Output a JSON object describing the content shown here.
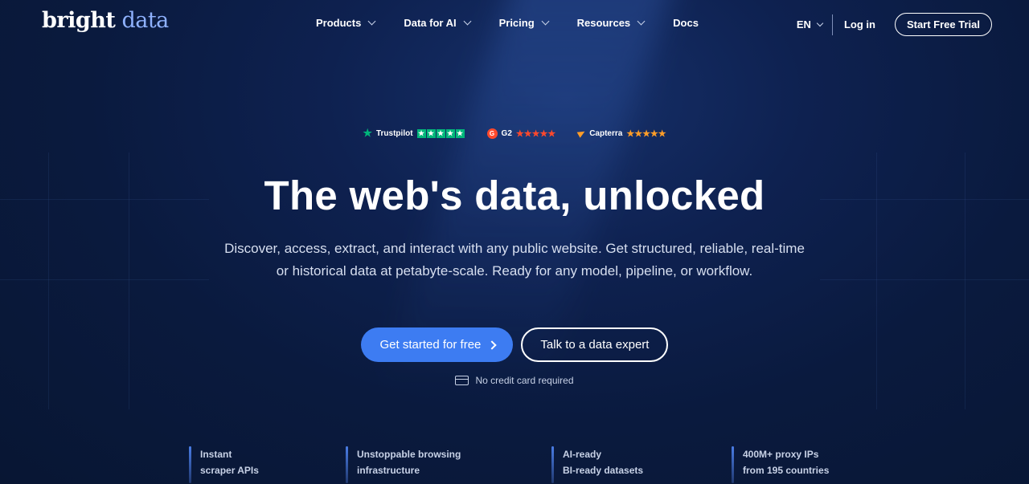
{
  "brand": {
    "word1": "bright",
    "word2": "data"
  },
  "nav": {
    "items": [
      {
        "label": "Products",
        "has_dropdown": true
      },
      {
        "label": "Data for AI",
        "has_dropdown": true
      },
      {
        "label": "Pricing",
        "has_dropdown": true
      },
      {
        "label": "Resources",
        "has_dropdown": true
      },
      {
        "label": "Docs",
        "has_dropdown": false
      }
    ],
    "language": "EN",
    "login": "Log in",
    "trial": "Start Free Trial"
  },
  "ratings": {
    "trustpilot": "Trustpilot",
    "g2": "G2",
    "g2_letter": "G",
    "capterra": "Capterra",
    "stars": "★★★★★"
  },
  "hero": {
    "title": "The web's data, unlocked",
    "subtitle_line1": "Discover, access, extract, and interact with any public website. Get structured, reliable, real-time",
    "subtitle_line2": "or historical data at petabyte-scale. Ready for any model, pipeline, or workflow.",
    "cta_primary": "Get started for free",
    "cta_secondary": "Talk to a data expert",
    "no_card": "No credit card required"
  },
  "features": [
    {
      "line1": "Instant",
      "line2": "scraper APIs"
    },
    {
      "line1": "Unstoppable browsing",
      "line2": "infrastructure"
    },
    {
      "line1": "AI-ready",
      "line2": "BI-ready datasets"
    },
    {
      "line1": "400M+ proxy IPs",
      "line2": "from 195 countries"
    }
  ],
  "colors": {
    "background": "#0a1a3e",
    "primary_button": "#3d7cf2",
    "brand_accent": "#8fb2ff",
    "trustpilot_green": "#00b67a",
    "g2_red": "#ff492c",
    "capterra_orange": "#ff9d28"
  }
}
